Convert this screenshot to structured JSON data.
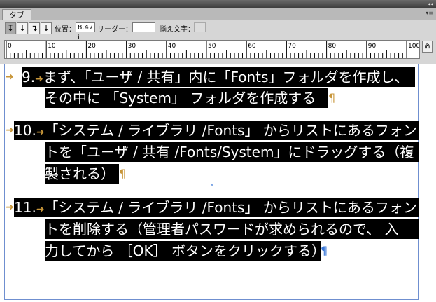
{
  "panel": {
    "collapse_glyph": "◂◂",
    "tab_label": "タブ",
    "menu_glyph": "▾≡",
    "tab_buttons": [
      "↧",
      "↓",
      "↴",
      "↓"
    ],
    "position_label": "位置：",
    "position_value": "8.47 i",
    "leader_label": "リーダー：",
    "leader_value": "",
    "align_label": "揃え文字：",
    "align_value": "",
    "ruler_labels": [
      "0",
      "10",
      "20",
      "30",
      "40",
      "50",
      "60",
      "70",
      "80",
      "90",
      "100"
    ],
    "magnet_glyph": "⋒"
  },
  "document": {
    "paragraphs": [
      {
        "number": "9.",
        "lines": [
          "まず、「ユーザ / 共有」内に「Fonts」フォルダを作成し、",
          "その中に 「System」 フォルダを作成する"
        ],
        "end_mark": "¶"
      },
      {
        "number": "10.",
        "lines": [
          "「システム / ライブラリ /Fonts」 からリストにあるフォン",
          "トを「ユーザ / 共有 /Fonts/System」にドラッグする（複",
          "製される）"
        ],
        "end_mark": "¶"
      },
      {
        "number": "11.",
        "lines": [
          "「システム / ライブラリ /Fonts」 からリストにあるフォン",
          "トを削除する（管理者パスワードが求められるので、 入",
          "力してから ［OK］ ボタンをクリックする）"
        ],
        "end_mark": "¶"
      }
    ],
    "tab_arrow": "➜",
    "anchor_glyph": "×"
  },
  "colors": {
    "highlight": "#000000",
    "text": "#ffffff",
    "marker": "#c8963a",
    "final_mark": "#3a78d8",
    "frame": "#6f8fd0"
  }
}
